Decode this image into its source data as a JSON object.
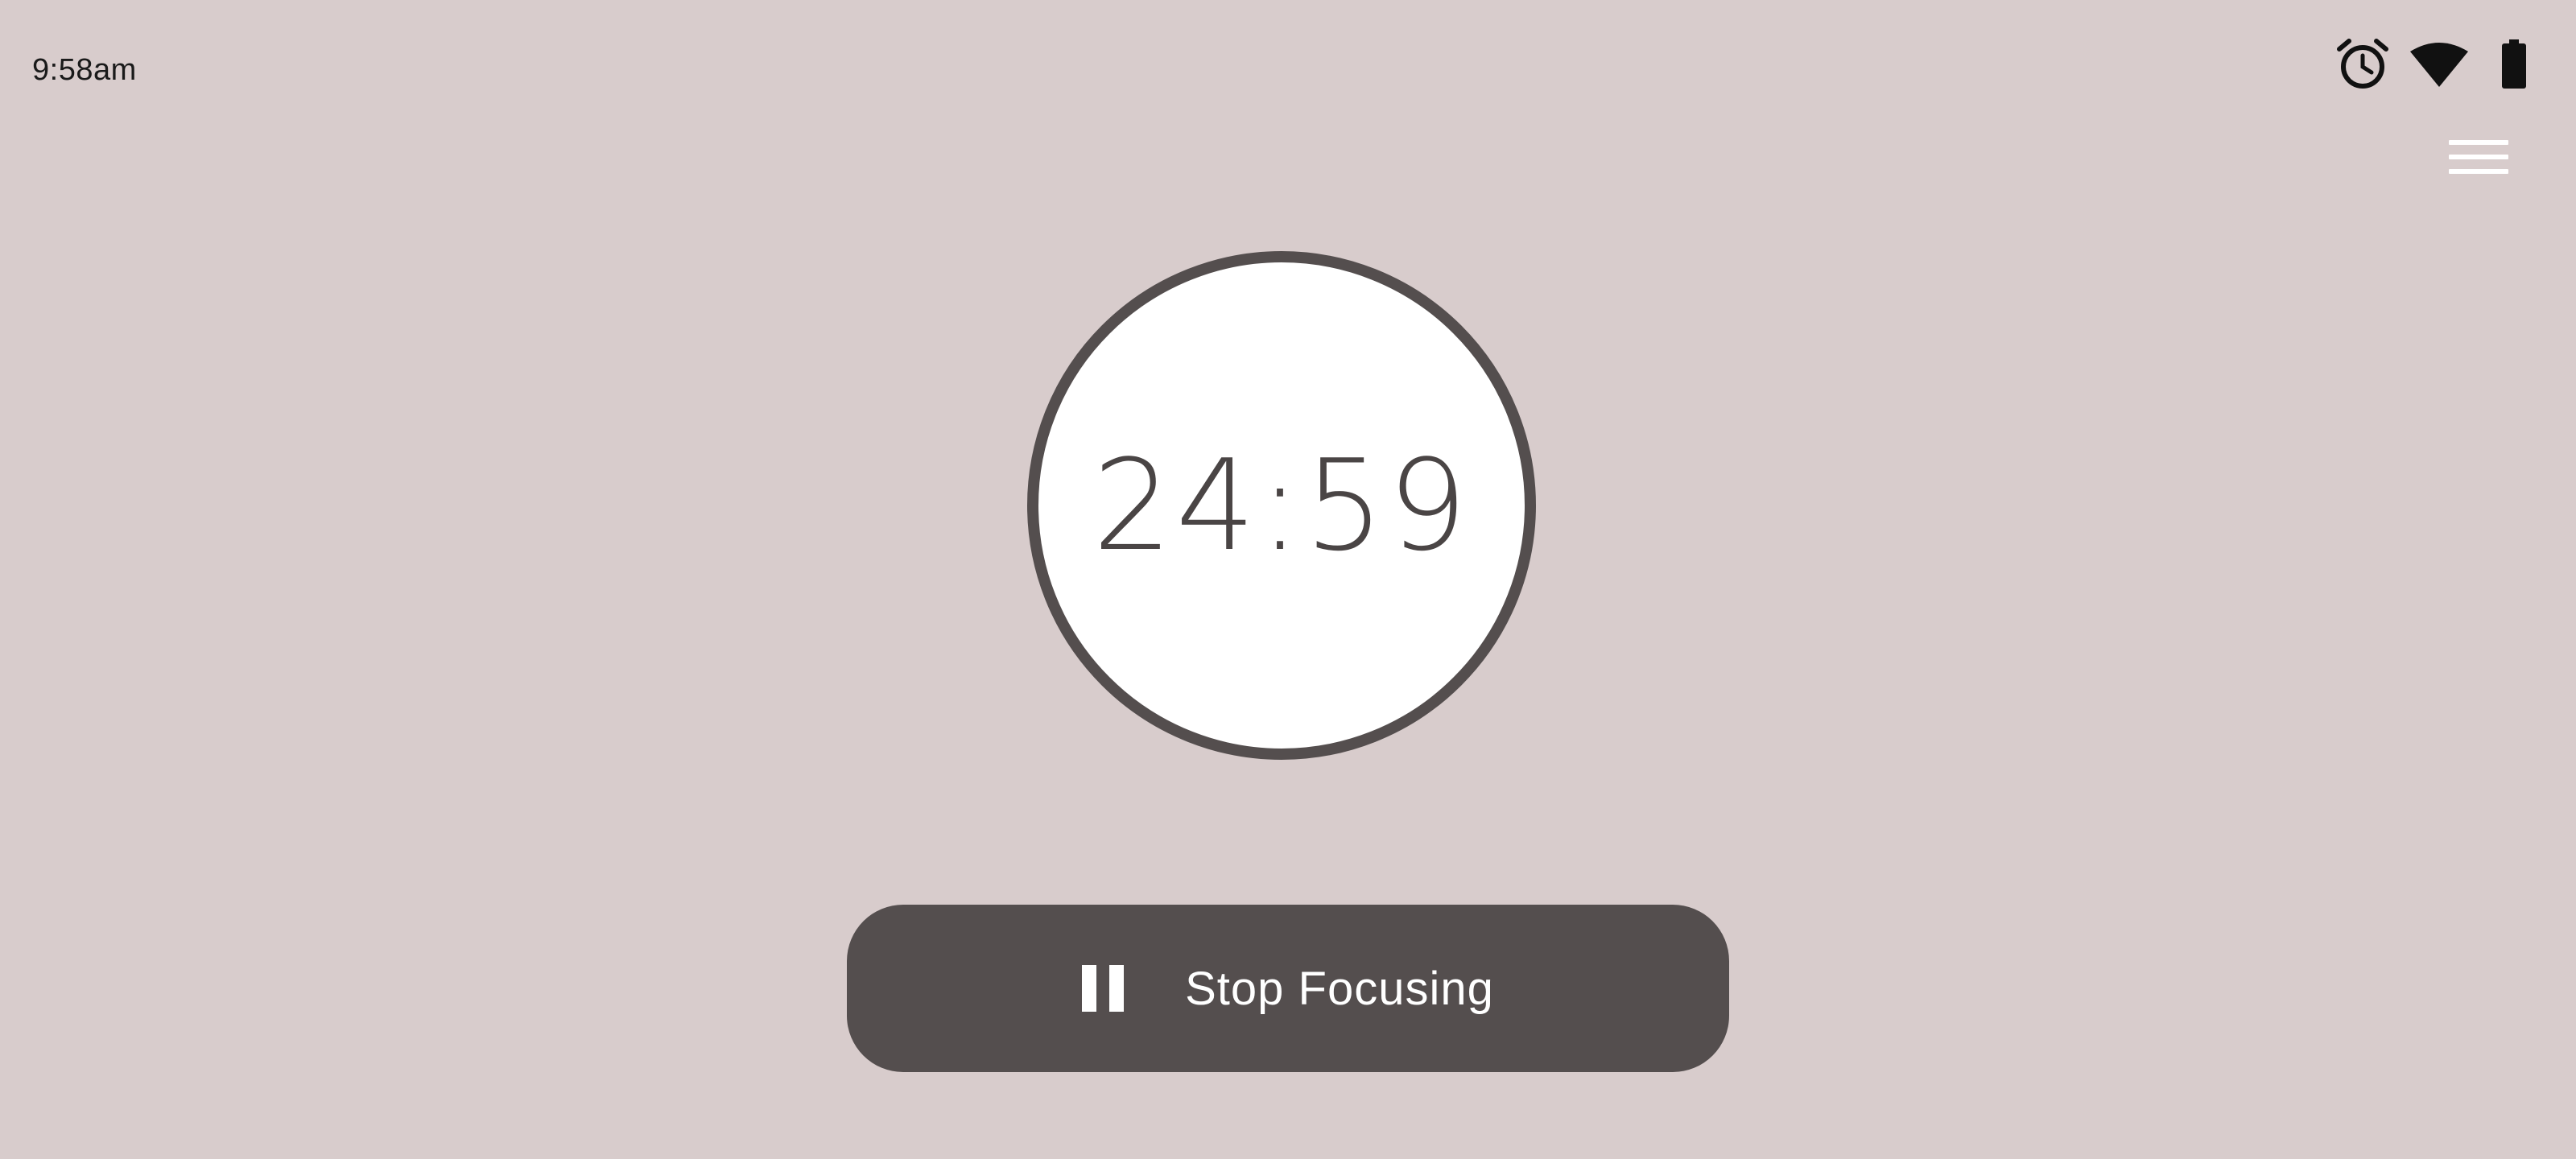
{
  "status_bar": {
    "time": "9:58am",
    "icons": [
      "alarm-icon",
      "wifi-icon",
      "battery-icon"
    ]
  },
  "header": {
    "menu_icon": "hamburger-menu-icon"
  },
  "timer": {
    "display": "24:59"
  },
  "action_button": {
    "icon": "pause-icon",
    "label": "Stop Focusing"
  },
  "colors": {
    "background": "#d8cccc",
    "accent_dark": "#544e4e",
    "timer_face": "#ffffff",
    "text_light": "#ffffff"
  }
}
